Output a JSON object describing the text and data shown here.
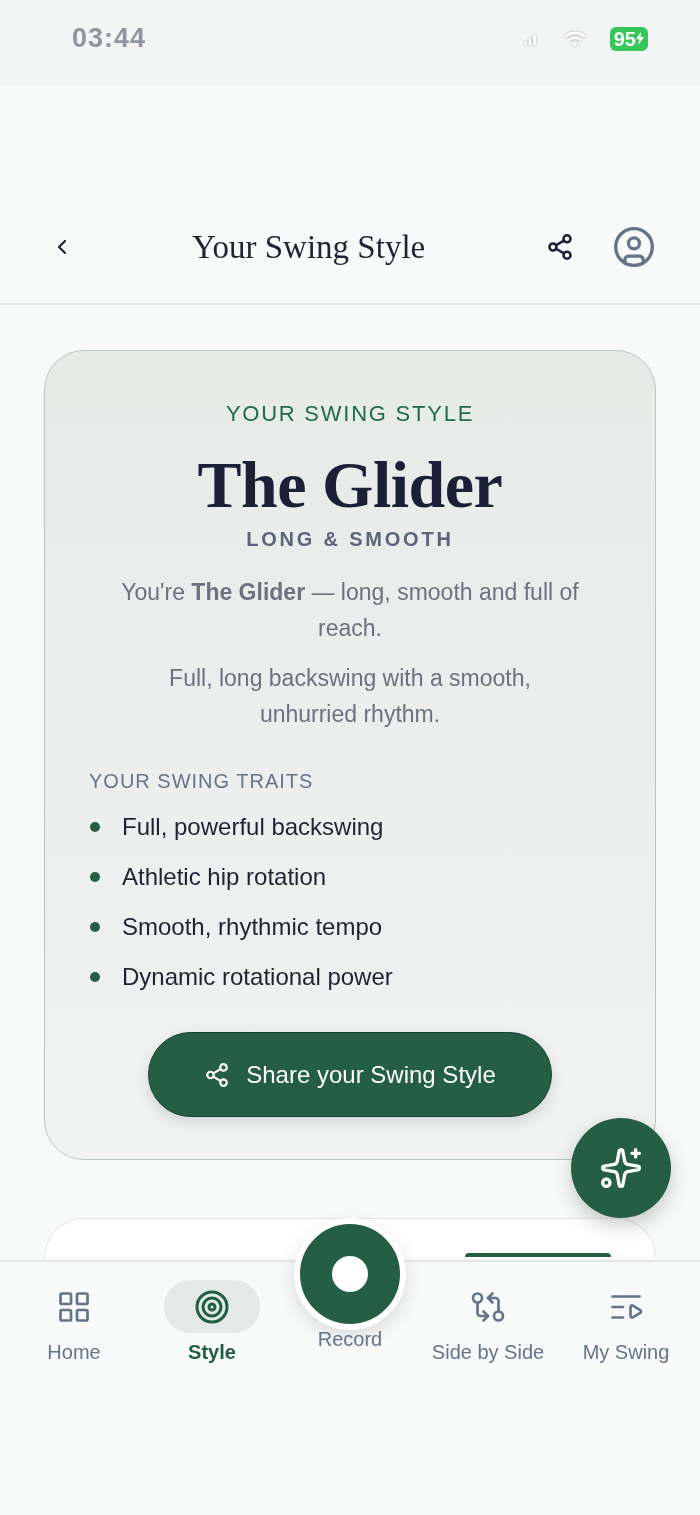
{
  "status_bar": {
    "time": "03:44",
    "battery": "95"
  },
  "header": {
    "title": "Your Swing Style"
  },
  "style_card": {
    "eyebrow": "YOUR SWING STYLE",
    "name": "The Glider",
    "tagline": "LONG & SMOOTH",
    "summary": "You're **The Glider** — long, smooth and full of reach.",
    "description": "Full, long backswing with a smooth, unhurried rhythm.",
    "traits_heading": "YOUR SWING TRAITS",
    "traits": [
      "Full, powerful backswing",
      "Athletic hip rotation",
      "Smooth, rhythmic tempo",
      "Dynamic rotational power"
    ],
    "share_button": "Share your Swing Style"
  },
  "nav": {
    "items": [
      {
        "label": "Home",
        "kind": "tab",
        "selected": false
      },
      {
        "label": "Style",
        "kind": "tab",
        "selected": true
      },
      {
        "label": "Record",
        "kind": "record",
        "selected": false
      },
      {
        "label": "Side by Side",
        "kind": "tab",
        "selected": false
      },
      {
        "label": "My Swing",
        "kind": "tab",
        "selected": false
      }
    ]
  }
}
